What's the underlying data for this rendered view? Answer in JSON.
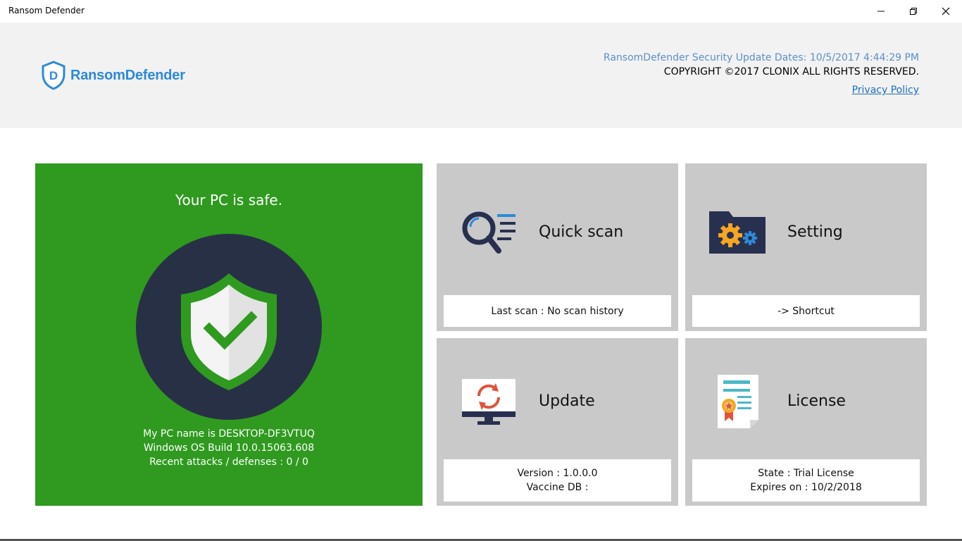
{
  "window": {
    "title": "Ransom Defender"
  },
  "header": {
    "logo_text": "RansomDefender",
    "logo_letter": "D",
    "update_dates": "RansomDefender Security Update Dates: 10/5/2017 4:44:29 PM",
    "copyright": "COPYRIGHT ©2017 CLONIX ALL RIGHTS RESERVED.",
    "privacy_policy": "Privacy Policy"
  },
  "status": {
    "title": "Your PC is safe.",
    "pc_name": "My PC name is DESKTOP-DF3VTUQ",
    "os_build": "Windows OS Build 10.0.15063.608",
    "attacks": "Recent attacks / defenses : 0 / 0"
  },
  "tiles": {
    "quick_scan": {
      "label": "Quick scan",
      "info": "Last scan : No scan history"
    },
    "setting": {
      "label": "Setting",
      "info": "-> Shortcut"
    },
    "update": {
      "label": "Update",
      "version": "Version : 1.0.0.0",
      "vaccine_db": "Vaccine DB :"
    },
    "license": {
      "label": "License",
      "state": "State : Trial License",
      "expires": "Expires on : 10/2/2018"
    }
  },
  "colors": {
    "safe_green": "#2f9a1f",
    "tile_gray": "#c9c9c9",
    "brand_blue": "#2d8ad8",
    "navy": "#283050"
  },
  "icons": [
    "shield-check-icon",
    "magnifier-list-icon",
    "folder-gears-icon",
    "monitor-refresh-icon",
    "certificate-icon"
  ]
}
